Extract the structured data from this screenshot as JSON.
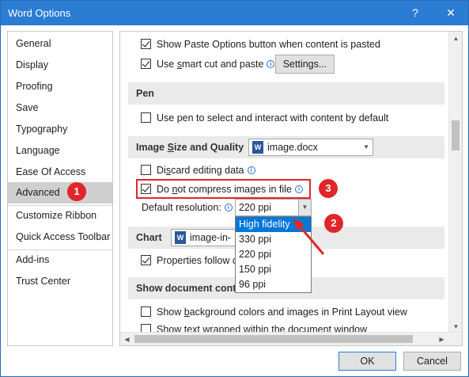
{
  "window": {
    "title": "Word Options",
    "help_glyph": "?",
    "close_glyph": "✕"
  },
  "sidebar": {
    "items": [
      {
        "label": "General"
      },
      {
        "label": "Display"
      },
      {
        "label": "Proofing"
      },
      {
        "label": "Save"
      },
      {
        "label": "Typography"
      },
      {
        "label": "Language"
      },
      {
        "label": "Ease Of Access"
      },
      {
        "label": "Advanced"
      },
      {
        "label": "Customize Ribbon"
      },
      {
        "label": "Quick Access Toolbar"
      },
      {
        "label": "Add-ins"
      },
      {
        "label": "Trust Center"
      }
    ],
    "active": "Advanced"
  },
  "content": {
    "cut_paste": {
      "show_paste_options": {
        "label": "Show Paste Options button when content is pasted",
        "checked": true
      },
      "smart_cut": {
        "label_prefix": "Use ",
        "label_underlined": "s",
        "label_suffix": "mart cut and paste",
        "checked": true
      },
      "settings_button": "Settings..."
    },
    "pen": {
      "header": "Pen",
      "use_pen": {
        "label": "Use pen to select and interact with content by default",
        "checked": false
      }
    },
    "image": {
      "header_prefix": "Image ",
      "header_underlined": "S",
      "header_suffix": "ize and Quality",
      "document": "image.docx",
      "discard_editing": {
        "label_prefix": "Di",
        "label_underlined": "s",
        "label_suffix": "card editing data",
        "checked": false
      },
      "no_compress": {
        "label_prefix": "Do ",
        "label_underlined": "n",
        "label_suffix": "ot compress images in file",
        "checked": true
      },
      "default_resolution_label": "Default resolution:",
      "default_resolution_value": "220 ppi",
      "resolution_options": [
        "High fidelity",
        "330 ppi",
        "220 ppi",
        "150 ppi",
        "96 ppi"
      ],
      "selected_option": "High fidelity"
    },
    "chart": {
      "header": "Chart",
      "document": "image-in-",
      "properties_follow": {
        "label": "Properties follow c",
        "checked": true
      }
    },
    "show_document": {
      "header": "Show document conte",
      "background_colors": {
        "label_prefix": "Show ",
        "label_underlined": "b",
        "label_suffix": "ackground colors and images in Print Layout view",
        "checked": false
      },
      "text_wrapped": {
        "label_prefix": "Show text ",
        "label_underlined": "w",
        "label_suffix": "rapped within the document window",
        "checked": false
      }
    }
  },
  "annotations": {
    "badge1": "1",
    "badge2": "2",
    "badge3": "3",
    "color": "#e0262a"
  },
  "footer": {
    "ok": "OK",
    "cancel": "Cancel"
  },
  "colors": {
    "titlebar": "#2b7cd3",
    "selection": "#0078d7",
    "active_item": "#cfcfcf"
  }
}
